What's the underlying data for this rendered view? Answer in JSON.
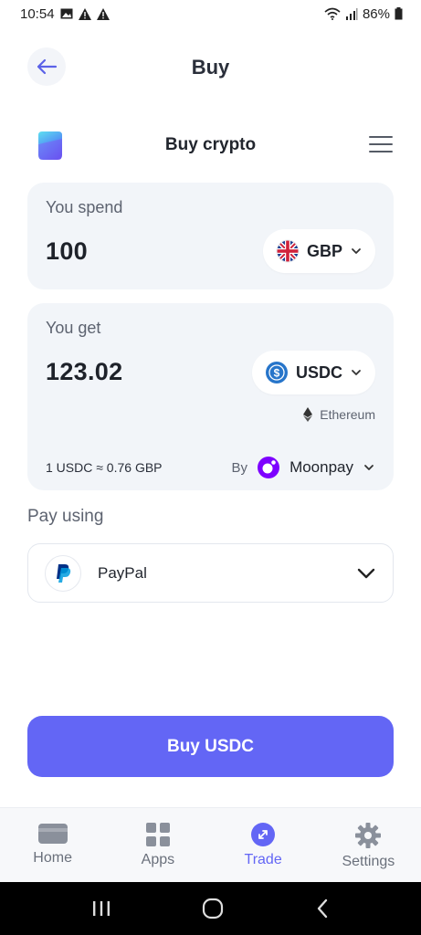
{
  "status_bar": {
    "time": "10:54",
    "battery": "86%"
  },
  "header": {
    "title": "Buy"
  },
  "widget": {
    "title": "Buy crypto"
  },
  "spend": {
    "label": "You spend",
    "amount": "100",
    "currency": "GBP"
  },
  "get": {
    "label": "You get",
    "amount": "123.02",
    "currency": "USDC",
    "network": "Ethereum",
    "rate": "1 USDC ≈ 0.76 GBP",
    "by_label": "By",
    "provider": "Moonpay"
  },
  "payment": {
    "label": "Pay using",
    "method": "PayPal"
  },
  "buy_button": {
    "label": "Buy USDC"
  },
  "bottom_nav": {
    "items": [
      {
        "label": "Home",
        "icon": "card-icon"
      },
      {
        "label": "Apps",
        "icon": "apps-grid-icon"
      },
      {
        "label": "Trade",
        "icon": "trade-icon"
      },
      {
        "label": "Settings",
        "icon": "gear-icon"
      }
    ],
    "active": "Trade"
  },
  "colors": {
    "accent": "#6366f5",
    "card_bg": "#f2f5f9",
    "text_primary": "#1f2430",
    "text_secondary": "#5d6370"
  }
}
